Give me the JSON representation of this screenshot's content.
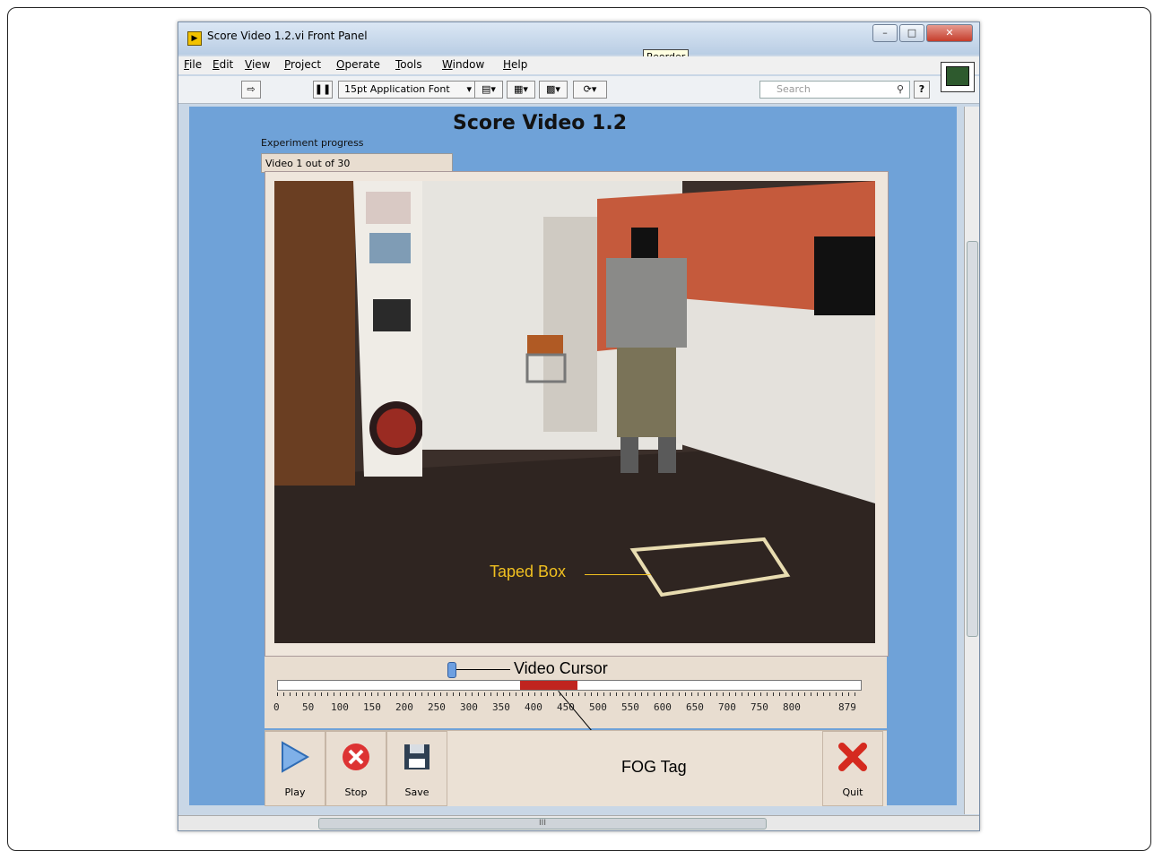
{
  "window": {
    "title": "Score Video 1.2.vi Front Panel",
    "tooltip": "Reorder"
  },
  "menu": [
    "File",
    "Edit",
    "View",
    "Project",
    "Operate",
    "Tools",
    "Window",
    "Help"
  ],
  "toolbar": {
    "font_select": "15pt Application Font",
    "search_placeholder": "Search"
  },
  "panel": {
    "title": "Score Video 1.2",
    "progress_label": "Experiment progress",
    "progress_value": "Video 1 out of  30"
  },
  "slider": {
    "ticks": [
      "0",
      "50",
      "100",
      "150",
      "200",
      "250",
      "300",
      "350",
      "400",
      "450",
      "500",
      "550",
      "600",
      "650",
      "700",
      "750",
      "800",
      "879"
    ],
    "cursor_value": 270,
    "fog_tag_range": [
      375,
      480
    ],
    "max": 879
  },
  "buttons": {
    "play": "Play",
    "stop": "Stop",
    "save": "Save",
    "quit": "Quit"
  },
  "annotations": {
    "taped_box": "Taped Box",
    "video_cursor": "Video Cursor",
    "fog_tag": "FOG Tag"
  },
  "scrollbar": {
    "grip": "III"
  },
  "colors": {
    "panel_bg": "#6fa2d8",
    "fog_tag": "#c0241f",
    "annotation_yellow": "#f0c020"
  }
}
